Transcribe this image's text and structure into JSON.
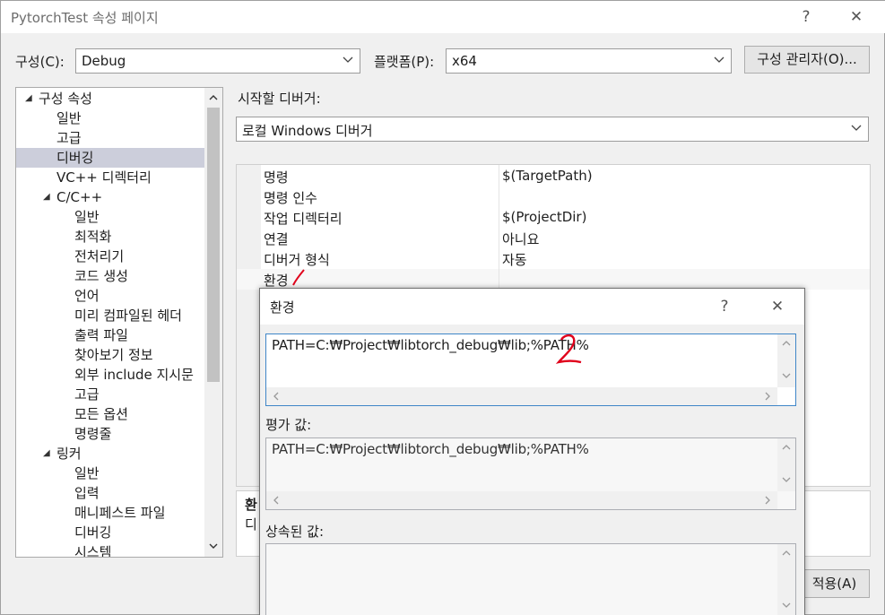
{
  "window": {
    "title": "PytorchTest 속성 페이지",
    "help_label": "?",
    "close_label": "✕"
  },
  "top_bar": {
    "config_label": "구성(C):",
    "config_value": "Debug",
    "platform_label": "플랫폼(P):",
    "platform_value": "x64",
    "config_manager_label": "구성 관리자(O)..."
  },
  "tree": {
    "items": [
      {
        "label": "구성 속성",
        "level": 0,
        "twisty": "◢"
      },
      {
        "label": "일반",
        "level": 1,
        "twisty": ""
      },
      {
        "label": "고급",
        "level": 1,
        "twisty": ""
      },
      {
        "label": "디버깅",
        "level": 1,
        "twisty": "",
        "selected": true
      },
      {
        "label": "VC++ 디렉터리",
        "level": 1,
        "twisty": ""
      },
      {
        "label": "C/C++",
        "level": 1,
        "twisty": "◢"
      },
      {
        "label": "일반",
        "level": 2,
        "twisty": ""
      },
      {
        "label": "최적화",
        "level": 2,
        "twisty": ""
      },
      {
        "label": "전처리기",
        "level": 2,
        "twisty": ""
      },
      {
        "label": "코드 생성",
        "level": 2,
        "twisty": ""
      },
      {
        "label": "언어",
        "level": 2,
        "twisty": ""
      },
      {
        "label": "미리 컴파일된 헤더",
        "level": 2,
        "twisty": ""
      },
      {
        "label": "출력 파일",
        "level": 2,
        "twisty": ""
      },
      {
        "label": "찾아보기 정보",
        "level": 2,
        "twisty": ""
      },
      {
        "label": "외부 include 지시문",
        "level": 2,
        "twisty": ""
      },
      {
        "label": "고급",
        "level": 2,
        "twisty": ""
      },
      {
        "label": "모든 옵션",
        "level": 2,
        "twisty": ""
      },
      {
        "label": "명령줄",
        "level": 2,
        "twisty": ""
      },
      {
        "label": "링커",
        "level": 1,
        "twisty": "◢"
      },
      {
        "label": "일반",
        "level": 2,
        "twisty": ""
      },
      {
        "label": "입력",
        "level": 2,
        "twisty": ""
      },
      {
        "label": "매니페스트 파일",
        "level": 2,
        "twisty": ""
      },
      {
        "label": "디버깅",
        "level": 2,
        "twisty": ""
      },
      {
        "label": "시스템",
        "level": 2,
        "twisty": ""
      }
    ]
  },
  "debugger": {
    "start_label": "시작할 디버거:",
    "start_value": "로컬 Windows 디버거"
  },
  "grid": {
    "rows": [
      {
        "name": "명령",
        "value": "$(TargetPath)"
      },
      {
        "name": "명령 인수",
        "value": ""
      },
      {
        "name": "작업 디렉터리",
        "value": "$(ProjectDir)"
      },
      {
        "name": "연결",
        "value": "아니요"
      },
      {
        "name": "디버거 형식",
        "value": "자동"
      },
      {
        "name": "환경",
        "value": ""
      }
    ]
  },
  "description": {
    "title_partial": "환",
    "text_partial": "디"
  },
  "apply_label": "적용(A)",
  "dialog": {
    "title": "환경",
    "help_label": "?",
    "close_label": "✕",
    "value": "PATH=C:₩Project₩libtorch_debug₩lib;%PATH%",
    "evaluated_label": "평가 값:",
    "evaluated_value": "PATH=C:₩Project₩libtorch_debug₩lib;%PATH%",
    "inherited_label": "상속된 값:",
    "inherited_value": ""
  },
  "annotations": {
    "mark_1": "/",
    "mark_2": "2",
    "color": "#e0001b"
  }
}
